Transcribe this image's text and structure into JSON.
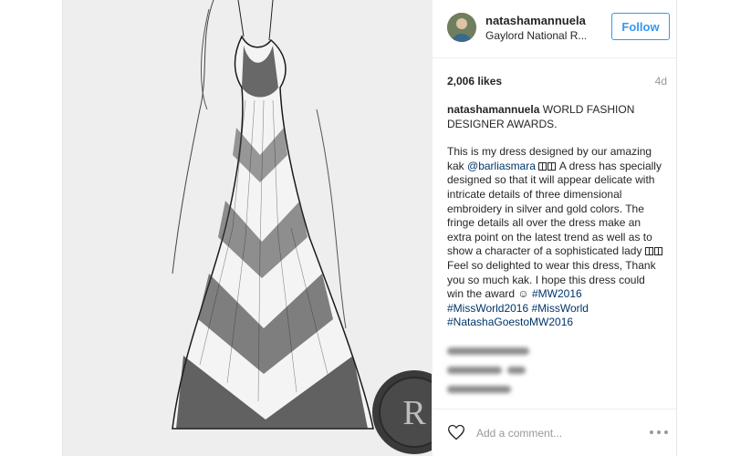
{
  "post": {
    "username": "natashamannuela",
    "location": "Gaylord National R...",
    "follow_label": "Follow",
    "likes": "2,006 likes",
    "age": "4d",
    "image_icon": "dress-sketch",
    "seal_letters": "R",
    "caption": {
      "username": "natashamannuela",
      "title": "WORLD FASHION DESIGNER AWARDS.",
      "p1": "This is my dress designed by our amazing kak",
      "mention": "@barliasmara",
      "p2": "A dress has specially designed so that it will appear delicate with intricate details of three dimensional embroidery in silver and gold colors. The fringe details all over the dress make an extra point on the latest trend as well as to show a character of a sophisticated lady",
      "p3": "Feel so delighted to wear this dress, Thank you so much kak. I hope this dress could win the award",
      "emoji_smile": "☺",
      "hashtags": [
        "#MW2016",
        "#MissWorld2016",
        "#MissWorld",
        "#NatashaGoestoMW2016"
      ]
    },
    "comment_placeholder": "Add a comment...",
    "icons": {
      "like": "heart-icon",
      "more": "more-options-icon"
    },
    "colors": {
      "link": "#003569",
      "follow": "#3897f0",
      "muted": "#999999"
    }
  }
}
